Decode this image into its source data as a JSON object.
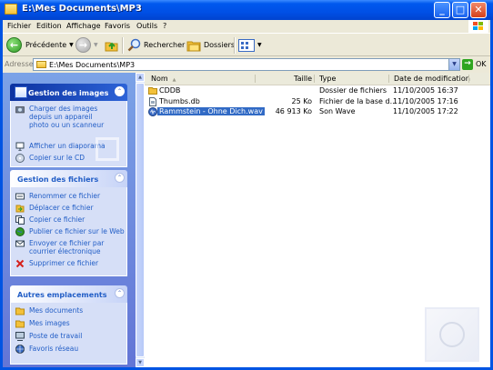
{
  "window": {
    "title": "E:\\Mes Documents\\MP3",
    "controls": {
      "minimize": "_",
      "maximize": "□",
      "close": "✕"
    }
  },
  "menu": [
    "Fichier",
    "Edition",
    "Affichage",
    "Favoris",
    "Outils",
    "?"
  ],
  "toolbar": {
    "back_label": "Précédente",
    "search_label": "Rechercher",
    "folders_label": "Dossiers"
  },
  "address": {
    "label": "Adresse",
    "value": "E:\\Mes Documents\\MP3",
    "go_label": "OK"
  },
  "sidebar": {
    "images_panel": {
      "title": "Gestion des images",
      "items": [
        {
          "label": "Charger des images depuis un appareil photo ou un scanneur",
          "icon": "camera-icon"
        },
        {
          "label": "Afficher un diaporama",
          "icon": "slideshow-icon"
        },
        {
          "label": "Copier sur le CD",
          "icon": "cd-icon"
        }
      ]
    },
    "files_panel": {
      "title": "Gestion des fichiers",
      "items": [
        {
          "label": "Renommer ce fichier",
          "icon": "rename-icon"
        },
        {
          "label": "Déplacer ce fichier",
          "icon": "move-icon"
        },
        {
          "label": "Copier ce fichier",
          "icon": "copy-icon"
        },
        {
          "label": "Publier ce fichier sur le Web",
          "icon": "globe-icon"
        },
        {
          "label": "Envoyer ce fichier par courrier électronique",
          "icon": "email-icon"
        },
        {
          "label": "Supprimer ce fichier",
          "icon": "delete-icon"
        }
      ]
    },
    "places_panel": {
      "title": "Autres emplacements",
      "items": [
        {
          "label": "Mes documents",
          "icon": "folder-icon"
        },
        {
          "label": "Mes images",
          "icon": "folder-icon"
        },
        {
          "label": "Poste de travail",
          "icon": "computer-icon"
        },
        {
          "label": "Favoris réseau",
          "icon": "network-icon"
        }
      ]
    }
  },
  "file_list": {
    "columns": [
      "Nom",
      "Taille",
      "Type",
      "Date de modification"
    ],
    "rows": [
      {
        "name": "CDDB",
        "size": "",
        "type": "Dossier de fichiers",
        "date": "11/10/2005 16:37",
        "icon": "folder-icon"
      },
      {
        "name": "Thumbs.db",
        "size": "25 Ko",
        "type": "Fichier de la base d...",
        "date": "11/10/2005 17:16",
        "icon": "db-file-icon"
      },
      {
        "name": "Rammstein - Ohne Dich.wav",
        "size": "46 913 Ko",
        "type": "Son Wave",
        "date": "11/10/2005 17:22",
        "icon": "wave-file-icon",
        "selected": true
      }
    ]
  },
  "colors": {
    "titlebar": "#0058ee",
    "selection": "#316ac5",
    "task_link": "#215dc6",
    "panel_bg": "#d6dff7"
  }
}
